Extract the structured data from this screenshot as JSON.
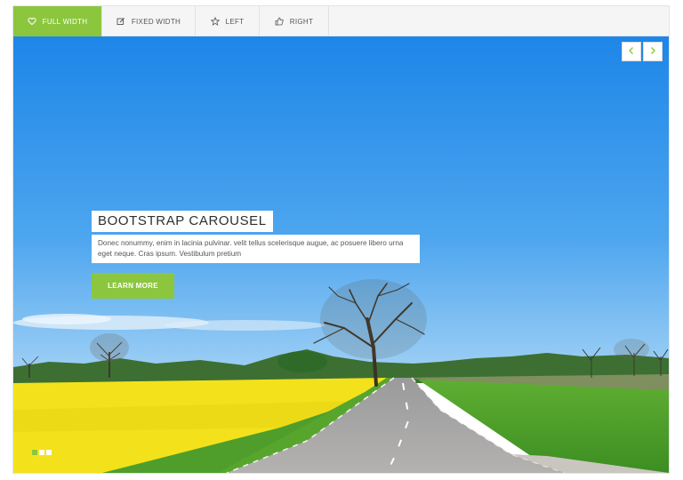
{
  "tabs": [
    {
      "label": "FULL WIDTH",
      "icon": "heart-icon",
      "active": true
    },
    {
      "label": "FIXED WIDTH",
      "icon": "edit-icon",
      "active": false
    },
    {
      "label": "LEFT",
      "icon": "star-icon",
      "active": false
    },
    {
      "label": "RIGHT",
      "icon": "thumbs-up-icon",
      "active": false
    }
  ],
  "carousel": {
    "title": "BOOTSTRAP CAROUSEL",
    "text": "Donec nonummy, enim in lacinia pulvinar. velit tellus scelerisque augue, ac posuere libero urna eget neque. Cras ipsum. Vestibulum pretium",
    "button_label": "LEARN MORE",
    "prev_icon": "chevron-left-icon",
    "next_icon": "chevron-right-icon",
    "slide_count": 3,
    "active_slide": 1
  },
  "colors": {
    "accent": "#8cc63f",
    "sky": "#2d92ea",
    "field": "#f2e21a",
    "grass": "#4f9e2c"
  }
}
